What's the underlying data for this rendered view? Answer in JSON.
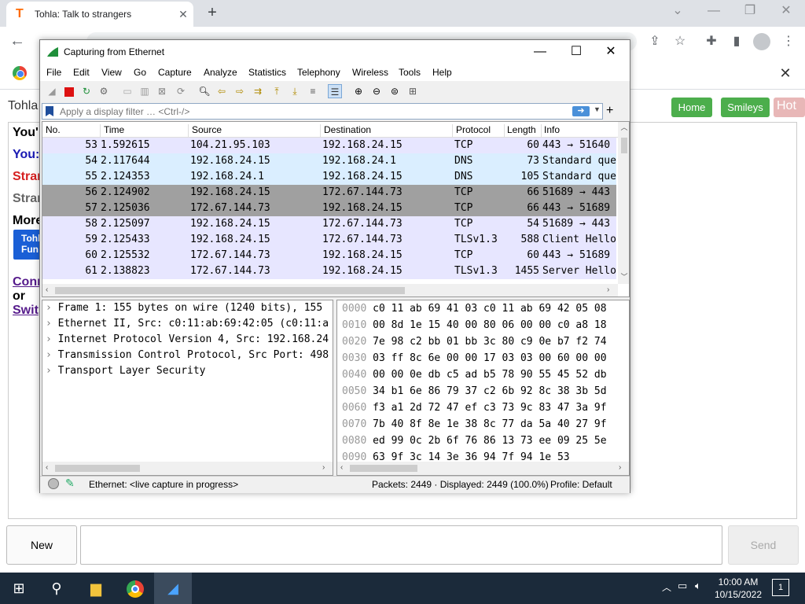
{
  "browser": {
    "tab_title": "Tohla: Talk to strangers",
    "tab_favicon": "T",
    "new_tab_icon": "+",
    "close_icon": "✕"
  },
  "site": {
    "brand": "Tohla",
    "nav": {
      "home": "Home",
      "smileys": "Smileys",
      "hot": "Hot"
    },
    "lines": [
      {
        "text": "You'",
        "color": "#000000"
      },
      {
        "text": "You:",
        "color": "#1a1ab3"
      },
      {
        "text": "Stran",
        "color": "#d62020"
      },
      {
        "text": "Stran",
        "color": "#666666"
      },
      {
        "text": "More",
        "color": "#000000"
      }
    ],
    "promo": {
      "line1": "Tohl",
      "line2": "Fun"
    },
    "links": {
      "connect": "Conn",
      "or": "or",
      "switch": "Swit"
    },
    "new_button": "New",
    "send_button": "Send"
  },
  "wireshark": {
    "title": "Capturing from Ethernet",
    "menus": [
      "File",
      "Edit",
      "View",
      "Go",
      "Capture",
      "Analyze",
      "Statistics",
      "Telephony",
      "Wireless",
      "Tools",
      "Help"
    ],
    "filter_placeholder": "Apply a display filter … <Ctrl-/>",
    "filter_add": "+",
    "columns": [
      "No.",
      "Time",
      "Source",
      "Destination",
      "Protocol",
      "Length",
      "Info"
    ],
    "packets": [
      {
        "no": "53",
        "time": "1.592615",
        "src": "104.21.95.103",
        "dst": "192.168.24.15",
        "proto": "TCP",
        "len": "60",
        "info": "443 → 51640",
        "bg": "#e7e6ff"
      },
      {
        "no": "54",
        "time": "2.117644",
        "src": "192.168.24.15",
        "dst": "192.168.24.1",
        "proto": "DNS",
        "len": "73",
        "info": "Standard que",
        "bg": "#daeeff"
      },
      {
        "no": "55",
        "time": "2.124353",
        "src": "192.168.24.1",
        "dst": "192.168.24.15",
        "proto": "DNS",
        "len": "105",
        "info": "Standard que",
        "bg": "#daeeff"
      },
      {
        "no": "56",
        "time": "2.124902",
        "src": "192.168.24.15",
        "dst": "172.67.144.73",
        "proto": "TCP",
        "len": "66",
        "info": "51689 → 443",
        "bg": "#a0a0a0"
      },
      {
        "no": "57",
        "time": "2.125036",
        "src": "172.67.144.73",
        "dst": "192.168.24.15",
        "proto": "TCP",
        "len": "66",
        "info": "443 → 51689",
        "bg": "#a0a0a0"
      },
      {
        "no": "58",
        "time": "2.125097",
        "src": "192.168.24.15",
        "dst": "172.67.144.73",
        "proto": "TCP",
        "len": "54",
        "info": "51689 → 443",
        "bg": "#e7e6ff"
      },
      {
        "no": "59",
        "time": "2.125433",
        "src": "192.168.24.15",
        "dst": "172.67.144.73",
        "proto": "TLSv1.3",
        "len": "588",
        "info": "Client Hello",
        "bg": "#e7e6ff"
      },
      {
        "no": "60",
        "time": "2.125532",
        "src": "172.67.144.73",
        "dst": "192.168.24.15",
        "proto": "TCP",
        "len": "60",
        "info": "443 → 51689",
        "bg": "#e7e6ff"
      },
      {
        "no": "61",
        "time": "2.138823",
        "src": "172.67.144.73",
        "dst": "192.168.24.15",
        "proto": "TLSv1.3",
        "len": "1455",
        "info": "Server Hello",
        "bg": "#e7e6ff"
      }
    ],
    "details": [
      "Frame 1: 155 bytes on wire (1240 bits), 155",
      "Ethernet II, Src: c0:11:ab:69:42:05 (c0:11:a",
      "Internet Protocol Version 4, Src: 192.168.24",
      "Transmission Control Protocol, Src Port: 498",
      "Transport Layer Security"
    ],
    "hex": [
      {
        "off": "0000",
        "bytes": "c0 11 ab 69 41 03 c0 11  ab 69 42 05 08"
      },
      {
        "off": "0010",
        "bytes": "00 8d 1e 15 40 00 80 06  00 00 c0 a8 18"
      },
      {
        "off": "0020",
        "bytes": "7e 98 c2 bb 01 bb 3c 80  c9 0e b7 f2 74"
      },
      {
        "off": "0030",
        "bytes": "03 ff 8c 6e 00 00 17 03  03 00 60 00 00"
      },
      {
        "off": "0040",
        "bytes": "00 00 0e db c5 ad b5 78  90 55 45 52 db"
      },
      {
        "off": "0050",
        "bytes": "34 b1 6e 86 79 37 c2 6b  92 8c 38 3b 5d"
      },
      {
        "off": "0060",
        "bytes": "f3 a1 2d 72 47 ef c3 73  9c 83 47 3a 9f"
      },
      {
        "off": "0070",
        "bytes": "7b 40 8f 8e 1e 38 8c 77  da 5a 40 27 9f"
      },
      {
        "off": "0080",
        "bytes": "ed 99 0c 2b 6f 76 86 13  73 ee 09 25 5e"
      },
      {
        "off": "0090",
        "bytes": "63 9f 3c 14 3e 36 94 7f  94 1e 53"
      }
    ],
    "status": {
      "interface": "Ethernet: <live capture in progress>",
      "packets": "Packets: 2449 · Displayed: 2449 (100.0%)",
      "profile": "Profile: Default"
    }
  },
  "taskbar": {
    "time": "10:00 AM",
    "date": "10/15/2022",
    "notification_count": "1"
  }
}
